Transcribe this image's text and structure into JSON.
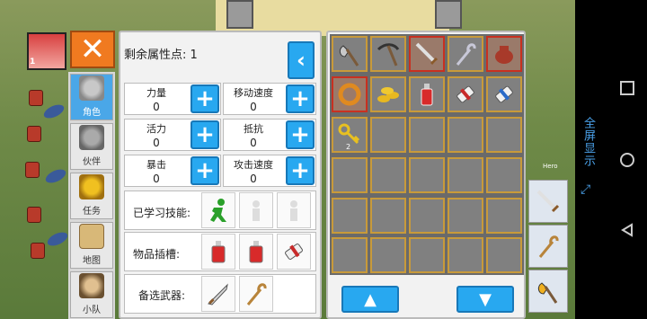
{
  "stats": {
    "points_label": "剩余属性点: 1",
    "items": [
      {
        "name": "力量",
        "value": "0"
      },
      {
        "name": "移动速度",
        "value": "0"
      },
      {
        "name": "活力",
        "value": "0"
      },
      {
        "name": "抵抗",
        "value": "0"
      },
      {
        "name": "暴击",
        "value": "0"
      },
      {
        "name": "攻击速度",
        "value": "0"
      }
    ],
    "skills_label": "已学习技能:",
    "slots_label": "物品插槽:",
    "weapons_label": "备选武器:"
  },
  "tabs": [
    {
      "label": "角色",
      "icon": "helmet-icon",
      "active": true
    },
    {
      "label": "伙伴",
      "icon": "horned-helmet-icon",
      "active": false
    },
    {
      "label": "任务",
      "icon": "trophy-icon",
      "active": false
    },
    {
      "label": "地图",
      "icon": "map-scroll-icon",
      "active": false
    },
    {
      "label": "小队",
      "icon": "party-icon",
      "active": false
    }
  ],
  "portrait": {
    "level": "1"
  },
  "inventory": {
    "rows": [
      [
        "axe-icon",
        "pickaxe-icon",
        "sword-icon",
        "staff-icon",
        "bag-icon"
      ],
      [
        "ring-icon",
        "coins-icon",
        "potion-icon",
        "scroll-icon",
        "scroll-icon"
      ],
      [
        "key-icon",
        "",
        "",
        "",
        ""
      ],
      [
        "",
        "",
        "",
        "",
        ""
      ],
      [
        "",
        "",
        "",
        "",
        ""
      ]
    ],
    "key_count": "2",
    "highlighted": [
      "sword-icon",
      "bag-icon",
      "ring-icon"
    ]
  },
  "side": {
    "fullscreen_label": "全屏显示",
    "hero_tag": "Hero"
  },
  "colors": {
    "accent_blue": "#28a8f0",
    "close_orange": "#f07a20",
    "slot_gold": "#c89a3a",
    "slot_red": "#c83020"
  }
}
